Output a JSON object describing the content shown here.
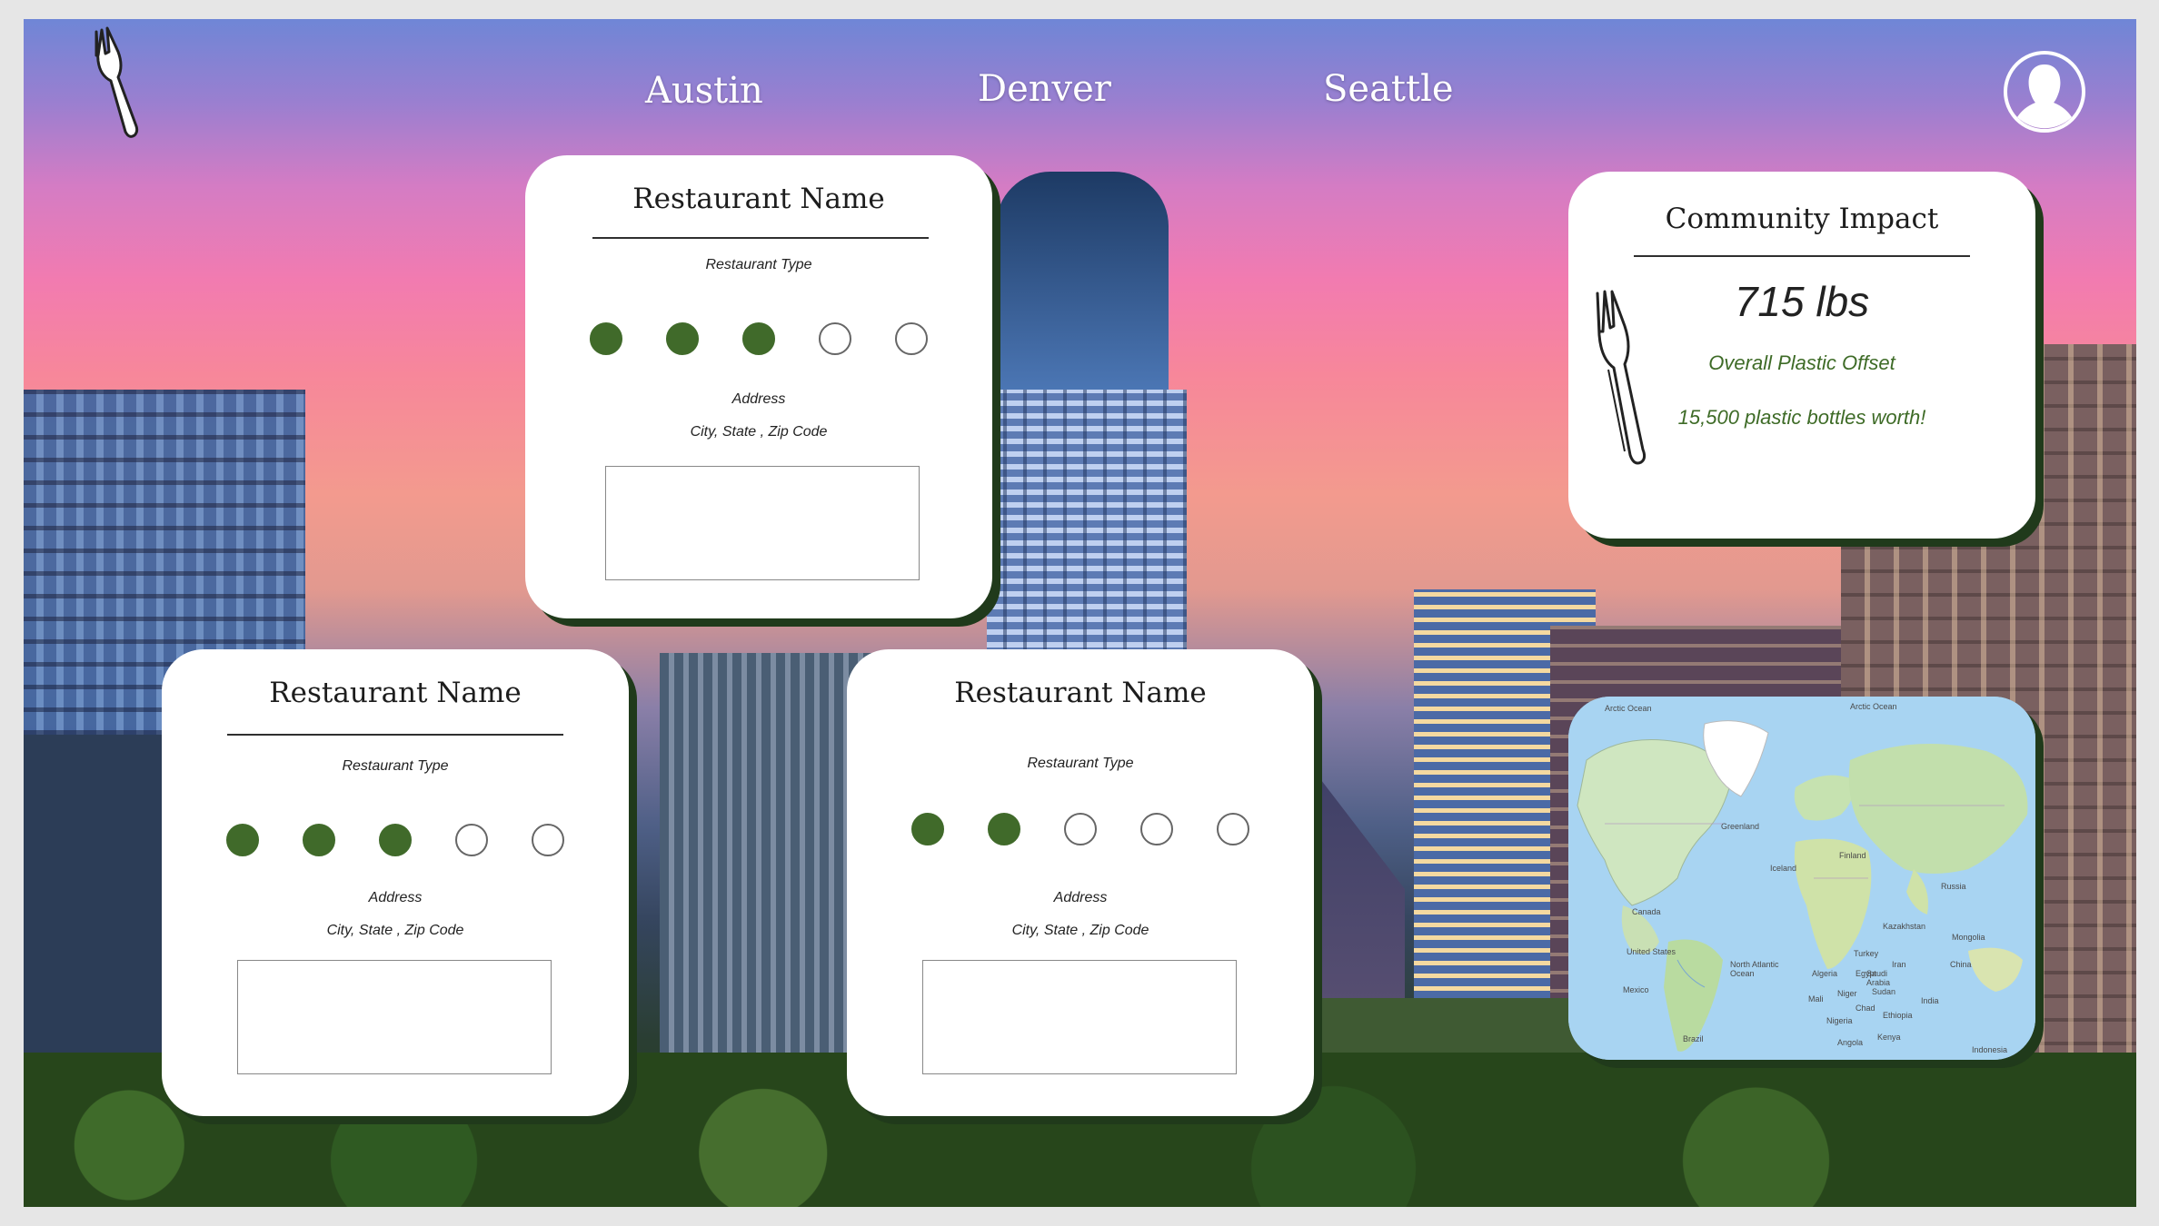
{
  "nav": {
    "links": [
      "Austin",
      "Denver",
      "Seattle"
    ]
  },
  "icons": {
    "logo": "fork-icon",
    "profile": "user-avatar-icon",
    "impact": "fork-icon"
  },
  "colors": {
    "accent_green": "#406a2a",
    "card_shadow": "#203a1b"
  },
  "restaurants": [
    {
      "name": "Restaurant Name",
      "type": "Restaurant Type",
      "rating": 3,
      "rating_max": 5,
      "address": "Address",
      "city_line": "City, State , Zip Code"
    },
    {
      "name": "Restaurant Name",
      "type": "Restaurant Type",
      "rating": 3,
      "rating_max": 5,
      "address": "Address",
      "city_line": "City, State , Zip Code"
    },
    {
      "name": "Restaurant Name",
      "type": "Restaurant Type",
      "rating": 2,
      "rating_max": 5,
      "address": "Address",
      "city_line": "City, State , Zip Code"
    }
  ],
  "impact": {
    "title": "Community Impact",
    "amount": "715 lbs",
    "label": "Overall Plastic Offset",
    "equivalent": "15,500 plastic bottles worth!"
  },
  "map": {
    "labels": [
      "Arctic Ocean",
      "Arctic Ocean",
      "Greenland",
      "North Atlantic Ocean",
      "Canada",
      "United States",
      "Russia",
      "Kazakhstan",
      "Mongolia",
      "China",
      "India",
      "Iran",
      "Egypt",
      "Algeria",
      "Mali",
      "Niger",
      "Nigeria",
      "Chad",
      "Sudan",
      "Ethiopia",
      "Kenya",
      "Angola",
      "Iceland",
      "Finland",
      "Turkey",
      "Saudi Arabia",
      "Mexico",
      "Brazil",
      "Indonesia"
    ]
  }
}
